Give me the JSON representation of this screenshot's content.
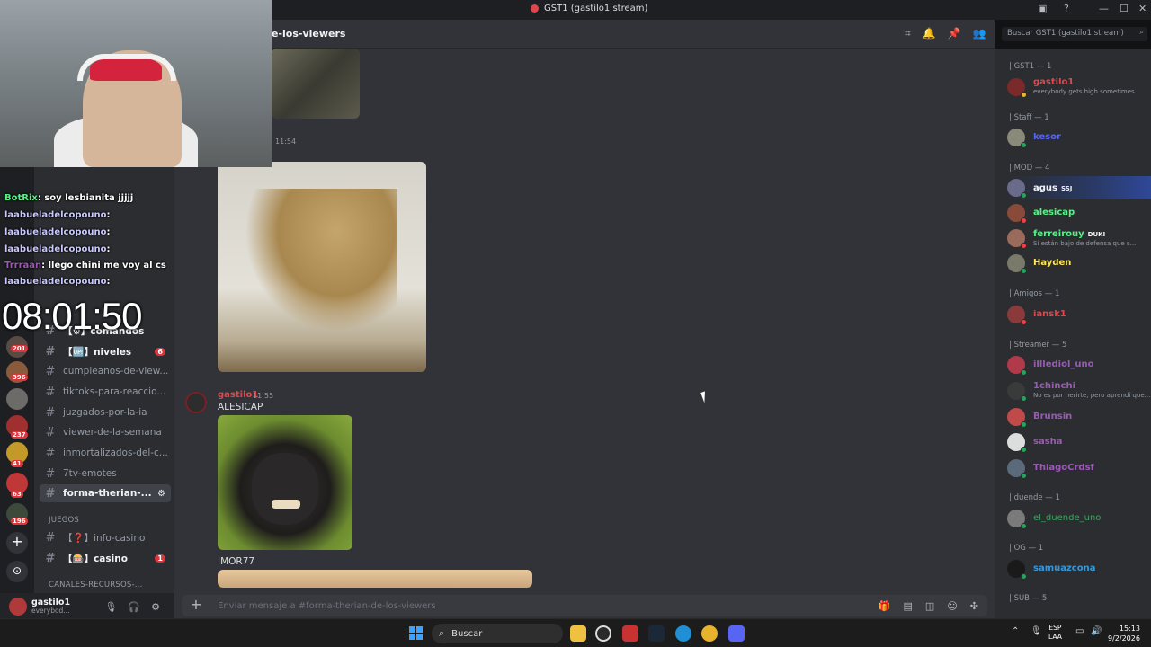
{
  "window": {
    "title": "GST1 (gastilo1 stream)"
  },
  "header": {
    "channel": "e-los-viewers",
    "search_placeholder": "Buscar GST1 (gastilo1 stream)"
  },
  "overlay": {
    "chat": [
      {
        "user": "BotRix",
        "text": ": soy lesbianita jjjjj"
      },
      {
        "user": "laabueladelcopouno",
        "text": ":"
      },
      {
        "user": "laabueladelcopouno",
        "text": ":"
      },
      {
        "user": "laabueladelcopouno",
        "text": ":"
      },
      {
        "user": "Trrraan",
        "text": ": llego chini me voy al cs"
      },
      {
        "user": "laabueladelcopouno",
        "text": ":"
      }
    ],
    "clock": "08:01:50"
  },
  "servers": {
    "badges": [
      "201",
      "396",
      "237",
      "41",
      "63",
      "196"
    ]
  },
  "channels": {
    "items": [
      {
        "label": "【⚙】comandos",
        "badge": ""
      },
      {
        "label": "【🆙】niveles",
        "badge": "6"
      },
      {
        "label": "cumpleanos-de-view...",
        "badge": ""
      },
      {
        "label": "tiktoks-para-reaccio...",
        "badge": ""
      },
      {
        "label": "juzgados-por-la-ia",
        "badge": ""
      },
      {
        "label": "viewer-de-la-semana",
        "badge": ""
      },
      {
        "label": "inmortalizados-del-c...",
        "badge": ""
      },
      {
        "label": "7tv-emotes",
        "badge": ""
      },
      {
        "label": "forma-therian-...",
        "badge": ""
      },
      {
        "label": "【❓】info-casino",
        "badge": ""
      },
      {
        "label": "【🎰】casino",
        "badge": "1"
      }
    ],
    "category_juegos": "JUEGOS",
    "category_recursos": "CANALES-RECURSOS-..."
  },
  "user": {
    "name": "gastilo1",
    "status": "everybod..."
  },
  "messages": {
    "time1": "11:54",
    "author2": "gastilo1",
    "time2": "11:55",
    "text2": "ALESICAP",
    "text3": "IMOR77"
  },
  "composer": {
    "placeholder": "Enviar mensaje a #forma-therian-de-los-viewers"
  },
  "members": {
    "groups": [
      {
        "label": "| GST1 — 1"
      },
      {
        "label": "| Staff — 1"
      },
      {
        "label": "| MOD — 4"
      },
      {
        "label": "| Amigos — 1"
      },
      {
        "label": "| Streamer — 5"
      },
      {
        "label": "| duende — 1"
      },
      {
        "label": "| OG — 1"
      },
      {
        "label": "| SUB — 5"
      }
    ],
    "people": [
      {
        "name": "gastilo1",
        "status": "everybody gets high sometimes",
        "tag": "",
        "color": "#e0474c",
        "dot": "#f0b232"
      },
      {
        "name": "kesor",
        "status": "",
        "tag": "",
        "color": "#5865f2",
        "dot": "#23a55a"
      },
      {
        "name": "agus",
        "status": "",
        "tag": "SSJ",
        "color": "#f2f3f5",
        "dot": "#23a55a"
      },
      {
        "name": "alesicap",
        "status": "",
        "tag": "",
        "color": "#57f287",
        "dot": "#f23f43"
      },
      {
        "name": "ferreirouy",
        "status": "Si están bajo de defensa que s...",
        "tag": "DUKI",
        "color": "#57f287",
        "dot": "#f23f43"
      },
      {
        "name": "Hayden",
        "status": "",
        "tag": "",
        "color": "#fee75c",
        "dot": "#23a55a"
      },
      {
        "name": "iansk1",
        "status": "",
        "tag": "",
        "color": "#f23f43",
        "dot": "#f23f43"
      },
      {
        "name": "illlediol_uno",
        "status": "",
        "tag": "",
        "color": "#9b59b6",
        "dot": "#23a55a"
      },
      {
        "name": "1chinchi",
        "status": "No es por herirte, pero aprendí que...",
        "tag": "",
        "color": "#9b59b6",
        "dot": "#23a55a"
      },
      {
        "name": "Brunsin",
        "status": "",
        "tag": "",
        "color": "#9b59b6",
        "dot": "#23a55a"
      },
      {
        "name": "sasha",
        "status": "",
        "tag": "",
        "color": "#9b59b6",
        "dot": "#23a55a"
      },
      {
        "name": "ThiagoCrdsf",
        "status": "",
        "tag": "",
        "color": "#9b59b6",
        "dot": "#23a55a"
      },
      {
        "name": "el_duende_uno",
        "status": "",
        "tag": "",
        "color": "#3ba55c",
        "dot": "#23a55a"
      },
      {
        "name": "samuazcona",
        "status": "",
        "tag": "",
        "color": "#3498db",
        "dot": "#23a55a"
      }
    ]
  },
  "taskbar": {
    "search": "Buscar",
    "lang": "ESP",
    "lang2": "LAA",
    "time": "15:13",
    "date": "9/2/2026"
  }
}
